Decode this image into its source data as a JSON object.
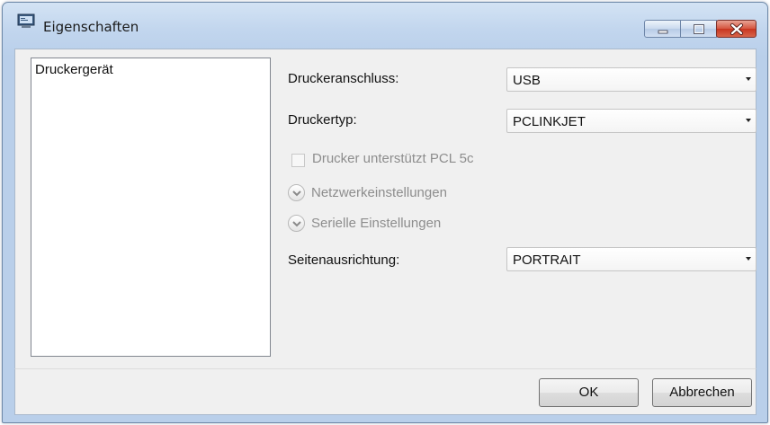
{
  "window": {
    "title": "Eigenschaften",
    "icons": {
      "app": "printer-properties-icon",
      "minimize": "minimize-icon",
      "maximize": "maximize-icon",
      "close": "close-icon"
    }
  },
  "sidebar": {
    "items": [
      {
        "label": "Druckergerät"
      }
    ]
  },
  "form": {
    "port": {
      "label": "Druckeranschluss:",
      "value": "USB"
    },
    "type": {
      "label": "Druckertyp:",
      "value": "PCLINKJET"
    },
    "pcl_checkbox": {
      "label": "Drucker unterstützt PCL 5c",
      "checked": false,
      "enabled": false
    },
    "network_expander": {
      "label": "Netzwerkeinstellungen",
      "enabled": false,
      "icon": "chevron-down-icon"
    },
    "serial_expander": {
      "label": "Serielle Einstellungen",
      "enabled": false,
      "icon": "chevron-down-icon"
    },
    "orientation": {
      "label": "Seitenausrichtung:",
      "value": "PORTRAIT"
    }
  },
  "buttons": {
    "ok": "OK",
    "cancel": "Abbrechen"
  }
}
